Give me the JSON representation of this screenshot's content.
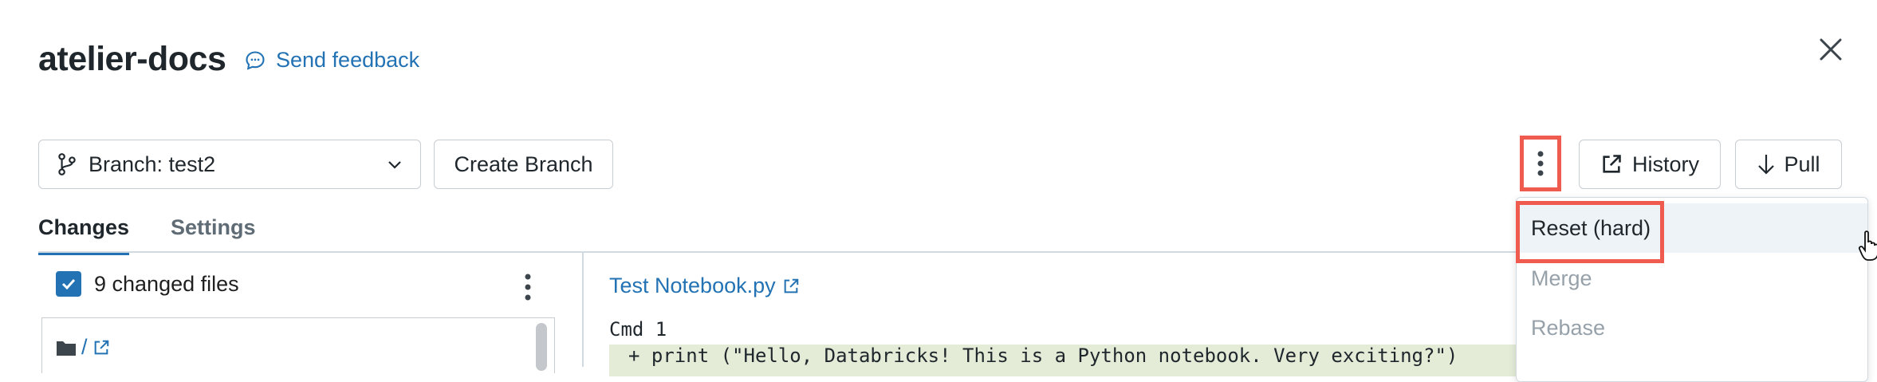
{
  "header": {
    "title": "atelier-docs",
    "feedback_label": "Send feedback"
  },
  "toolbar": {
    "branch_label": "Branch: test2",
    "create_branch_label": "Create Branch",
    "history_label": "History",
    "pull_label": "Pull"
  },
  "tabs": [
    {
      "label": "Changes",
      "active": true
    },
    {
      "label": "Settings",
      "active": false
    }
  ],
  "changes_panel": {
    "changed_files_label": "9 changed files",
    "root_folder": "/"
  },
  "diff": {
    "notebook_name": "Test Notebook.py",
    "cmd_label": "Cmd 1",
    "code_line": "+ print (\"Hello, Databricks! This is a Python notebook. Very exciting?\")"
  },
  "dropdown_menu": {
    "items": [
      {
        "label": "Reset (hard)",
        "enabled": true
      },
      {
        "label": "Merge",
        "enabled": false
      },
      {
        "label": "Rebase",
        "enabled": false
      }
    ]
  },
  "colors": {
    "accent": "#2272b4",
    "highlight": "#ef5b4e",
    "diff_added_bg": "#e4ecd8"
  }
}
